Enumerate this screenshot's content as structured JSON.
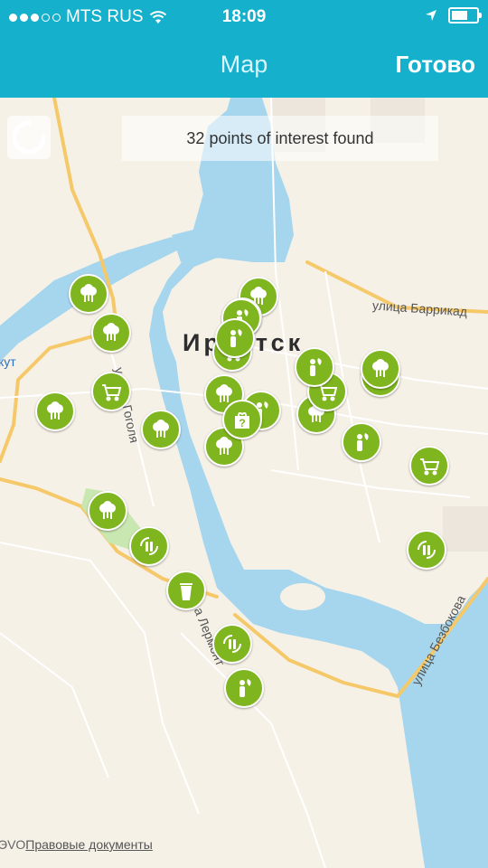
{
  "status": {
    "carrier": "MTS RUS",
    "time": "18:09",
    "battery_level": 0.65
  },
  "nav": {
    "title": "Map",
    "done": "Готово"
  },
  "map": {
    "banner": "32 points of interest found",
    "city": "Иркутск",
    "streets": {
      "barrikad": "улица Баррикад",
      "gogolya": "улица Гоголя",
      "lermontova": "а Лермонт",
      "bezbokova": "улица Безбокова",
      "kut": "кут"
    },
    "legal": {
      "prefix": "ЭVO",
      "link": "Правовые документы"
    }
  },
  "pins": [
    {
      "type": "park-icon"
    },
    {
      "type": "park-icon"
    },
    {
      "type": "park-icon"
    },
    {
      "type": "park-icon"
    },
    {
      "type": "park-icon"
    },
    {
      "type": "park-icon"
    },
    {
      "type": "park-icon"
    },
    {
      "type": "park-icon"
    },
    {
      "type": "park-icon"
    },
    {
      "type": "park-icon"
    },
    {
      "type": "park-icon"
    },
    {
      "type": "park-icon"
    },
    {
      "type": "cart-icon"
    },
    {
      "type": "cart-icon"
    },
    {
      "type": "cart-icon"
    },
    {
      "type": "cart-icon"
    },
    {
      "type": "person-leaf-icon"
    },
    {
      "type": "person-leaf-icon"
    },
    {
      "type": "person-leaf-icon"
    },
    {
      "type": "person-leaf-icon"
    },
    {
      "type": "person-leaf-icon"
    },
    {
      "type": "person-leaf-icon"
    },
    {
      "type": "recycle-bottles-icon"
    },
    {
      "type": "recycle-bottles-icon"
    },
    {
      "type": "recycle-bottles-icon"
    },
    {
      "type": "question-box-icon"
    },
    {
      "type": "recycle-bin-icon"
    }
  ]
}
